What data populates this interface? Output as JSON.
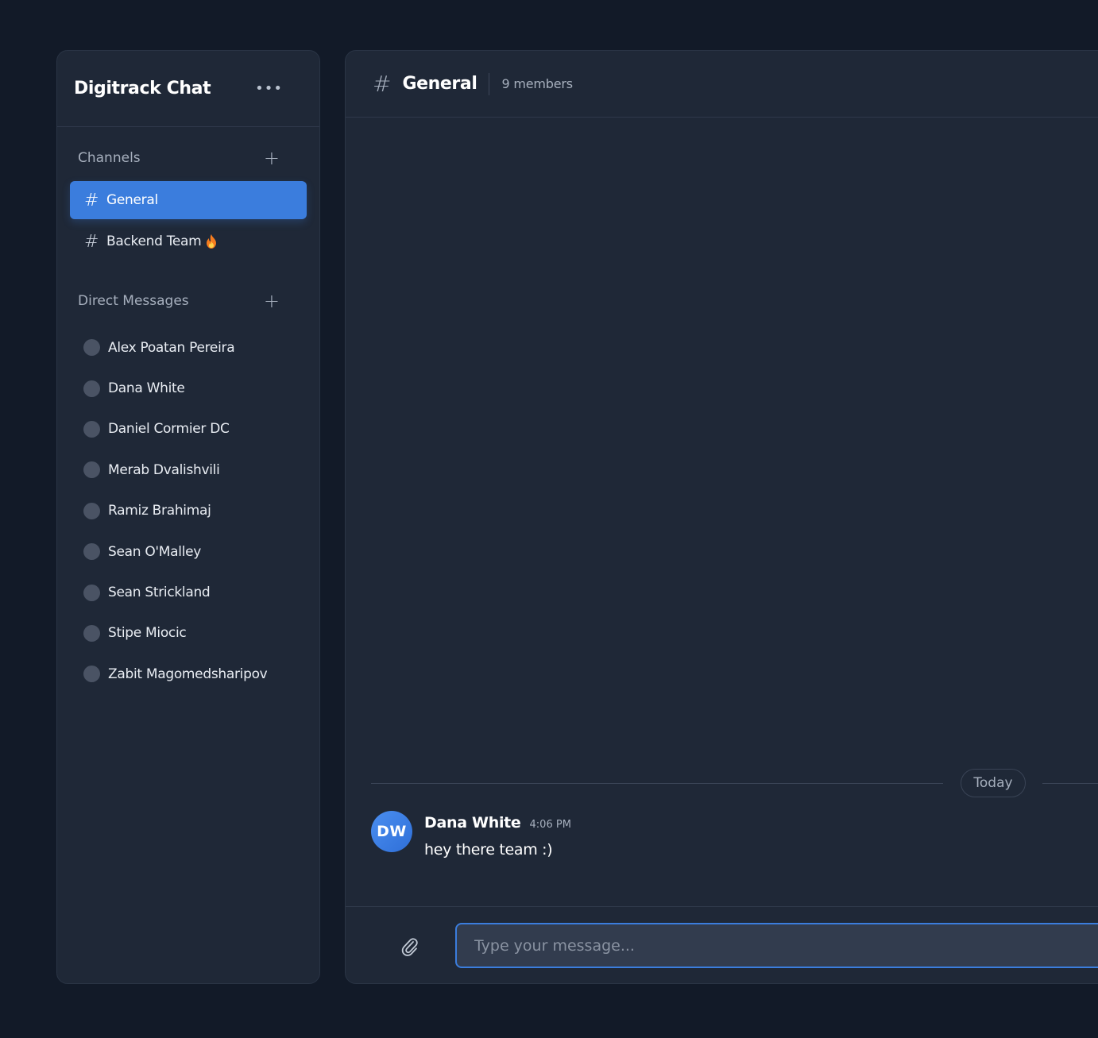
{
  "sidebar": {
    "title": "Digitrack Chat",
    "menu_icon": "more-horizontal-icon",
    "channels_title": "Channels",
    "channels": [
      {
        "label": "General",
        "active": true
      },
      {
        "label": "Backend Team",
        "active": false,
        "emoji": "fire-icon"
      }
    ],
    "dms_title": "Direct Messages",
    "dms": [
      {
        "label": "Alex Poatan Pereira"
      },
      {
        "label": "Dana White"
      },
      {
        "label": "Daniel Cormier DC"
      },
      {
        "label": "Merab Dvalishvili"
      },
      {
        "label": "Ramiz Brahimaj"
      },
      {
        "label": "Sean O'Malley"
      },
      {
        "label": "Sean Strickland"
      },
      {
        "label": "Stipe Miocic"
      },
      {
        "label": "Zabit Magomedsharipov"
      }
    ]
  },
  "main": {
    "channel_title": "General",
    "members": "9 members",
    "date_separator": "Today",
    "message": {
      "avatar_initials": "DW",
      "author": "Dana White",
      "time": "4:06 PM",
      "text": "hey there team :)"
    },
    "composer": {
      "placeholder": "Type your message..."
    }
  },
  "colors": {
    "background": "#121a28",
    "panel": "#1f2837",
    "accent": "#3b7ddd",
    "status_dot": "#4a5364"
  }
}
